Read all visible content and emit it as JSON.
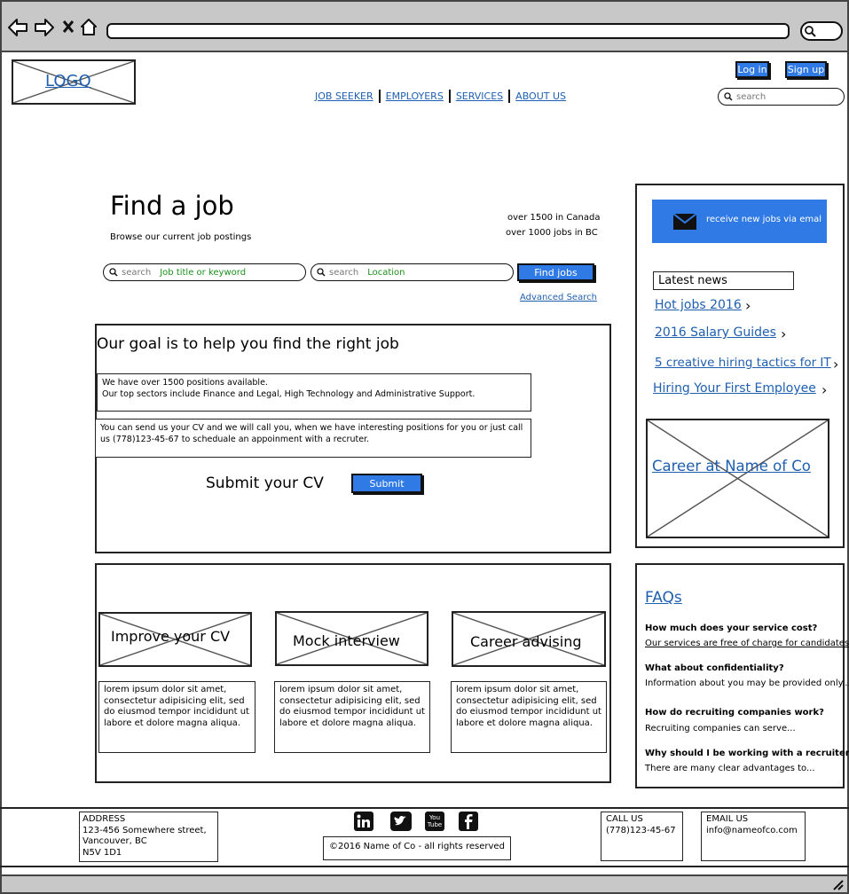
{
  "header": {
    "logo": "LOGO",
    "nav": [
      "JOB SEEKER",
      "EMPLOYERS",
      "SERVICES",
      "ABOUT US"
    ],
    "login_label": "Log in",
    "signup_label": "Sign up",
    "search_placeholder": "search"
  },
  "hero": {
    "title": "Find a job",
    "subtitle": "Browse our current job postings",
    "stat_canada": "over 1500 in Canada",
    "stat_bc": "over 1000 jobs in BC",
    "keyword_search_placeholder": "search",
    "keyword_hint": "Job title or keyword",
    "location_search_placeholder": "search",
    "location_hint": "Location",
    "find_button": "Find jobs",
    "advanced_search": "Advanced Search"
  },
  "goal": {
    "heading": "Our goal is to help you find the right job",
    "para1_line1": "We have over 1500 positions available.",
    "para1_line2": "Our top sectors include Finance and Legal, High Technology and Administrative Support.",
    "para2": "You can send us your CV and we will call you, when we have interesting positions for you or just call us (778)123-45-67 to scheduale an appoinment with a recruter.",
    "submit_cv_label": "Submit your CV",
    "submit_button": "Submit"
  },
  "services": [
    {
      "title": "Improve your CV",
      "body": "lorem ipsum dolor sit amet, consectetur adipisicing elit, sed do eiusmod tempor incididunt ut labore et dolore magna aliqua."
    },
    {
      "title": "Mock interview",
      "body": "lorem ipsum dolor sit amet, consectetur adipisicing elit, sed do eiusmod tempor incididunt ut labore et dolore magna aliqua."
    },
    {
      "title": "Career advising",
      "body": "lorem ipsum dolor sit amet, consectetur adipisicing elit, sed do eiusmod tempor incididunt ut labore et dolore magna aliqua."
    }
  ],
  "sidebar": {
    "subscribe_button": "receive new jobs via emal",
    "latest_news_heading": "Latest news",
    "news": [
      "Hot jobs 2016",
      "2016 Salary Guides",
      "5 creative hiring tactics for IT",
      "Hiring Your First Employee"
    ],
    "career_link": "Career at Name of Co"
  },
  "faqs": {
    "heading": "FAQs",
    "items": [
      {
        "q": "How much does your service cost?",
        "a": "Our services are free of charge for candidates"
      },
      {
        "q": "What about confidentiality?",
        "a": "Information about you may be provided only..."
      },
      {
        "q": "How do recruiting companies work?",
        "a": "Recruiting companies can serve..."
      },
      {
        "q": "Why should I be working with a recruiter?",
        "a": "There are many clear advantages to..."
      }
    ]
  },
  "footer": {
    "address_label": "ADDRESS",
    "address_line1": "123-456 Somewhere street,",
    "address_line2": "Vancouver, BC",
    "address_line3": "N5V 1D1",
    "copyright": "©2016 Name of Co - all rights reserved",
    "call_label": "CALL US",
    "phone": "(778)123-45-67",
    "email_label": "EMAIL US",
    "email": "info@nameofco.com",
    "social_icons": [
      "linkedin-icon",
      "twitter-icon",
      "youtube-icon",
      "facebook-icon"
    ],
    "youtube_text": "You Tube"
  },
  "colors": {
    "accent": "#2f7ae5",
    "link": "#1f5fb0",
    "hint_green": "#1d8f1d",
    "chrome": "#c8c8c8"
  }
}
